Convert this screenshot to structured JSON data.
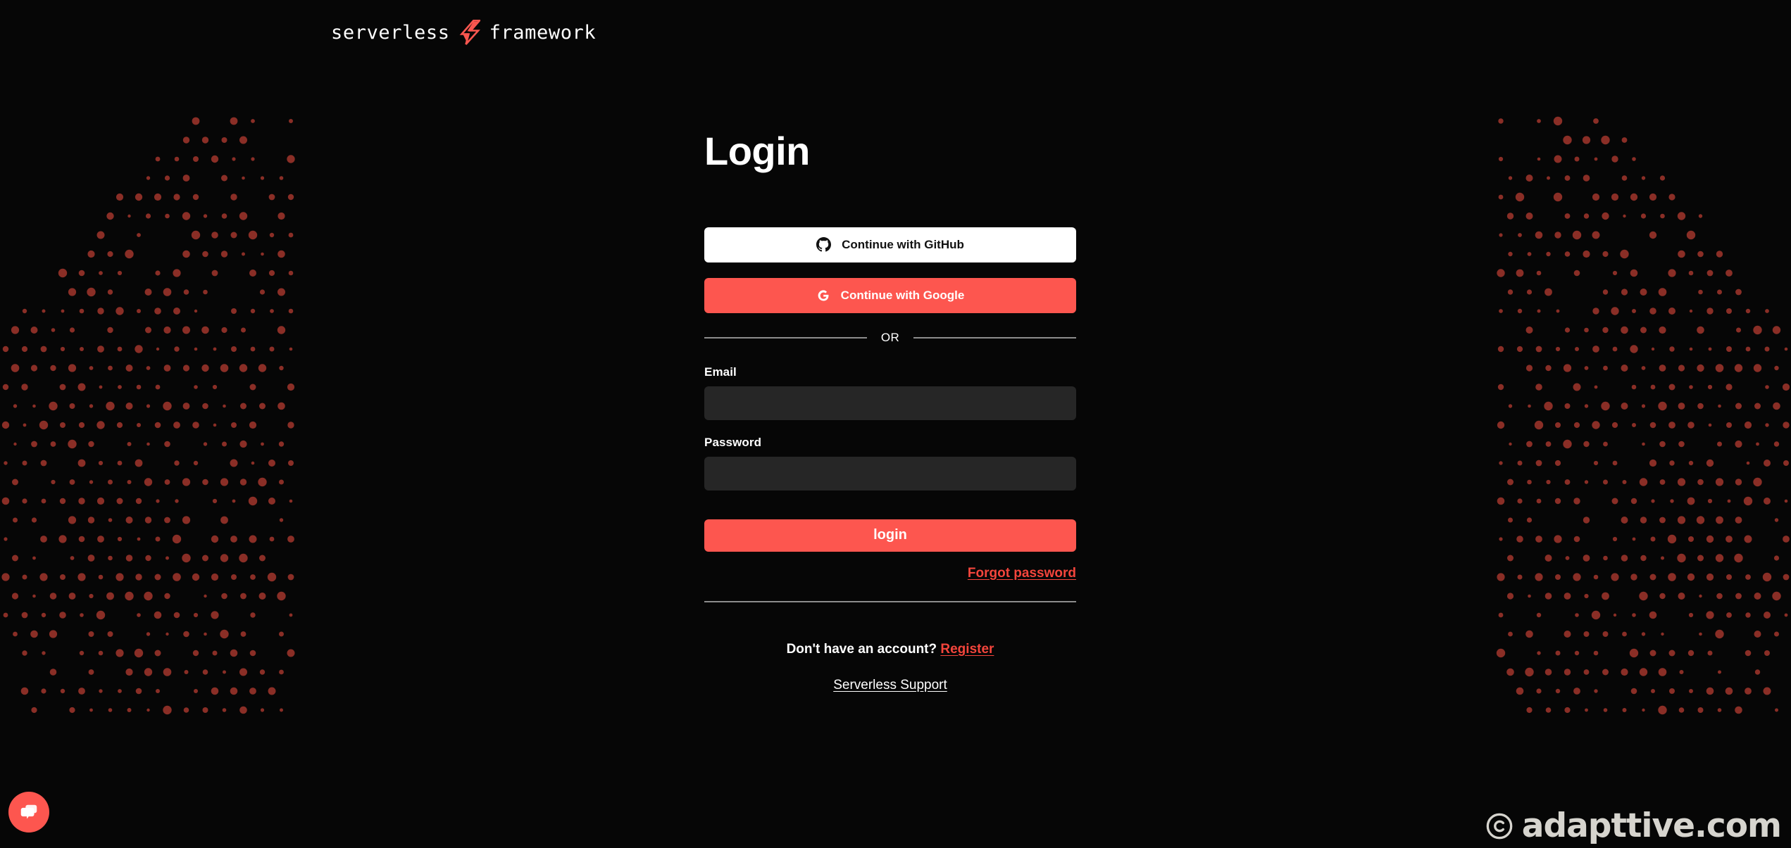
{
  "brand": {
    "word_left": "serverless",
    "word_right": "framework",
    "bolt_icon": "lightning-bolt-icon",
    "accent_color": "#fd564f",
    "bolt_color": "#f9564f",
    "background_color": "#060606",
    "dot_color": "#8a2e26"
  },
  "main": {
    "title": "Login"
  },
  "oauth": {
    "github": {
      "label": "Continue with GitHub",
      "icon": "github-icon",
      "background": "#ffffff",
      "text_color": "#111111"
    },
    "google": {
      "label": "Continue with Google",
      "icon": "google-icon",
      "background": "#fd564f",
      "text_color": "#ffffff"
    }
  },
  "divider": {
    "or_label": "OR"
  },
  "form": {
    "email": {
      "label": "Email",
      "value": "",
      "placeholder": ""
    },
    "password": {
      "label": "Password",
      "value": "",
      "placeholder": ""
    },
    "submit_label": "login",
    "forgot_password_label": "Forgot password"
  },
  "footer": {
    "register_prompt": "Don't have an account?",
    "register_label": "Register",
    "support_label": "Serverless Support"
  },
  "chat": {
    "icon": "chat-bubbles-icon",
    "background": "#fd564f"
  },
  "watermark": {
    "copyright_icon": "copyright-icon",
    "text": "adapttive.com"
  }
}
